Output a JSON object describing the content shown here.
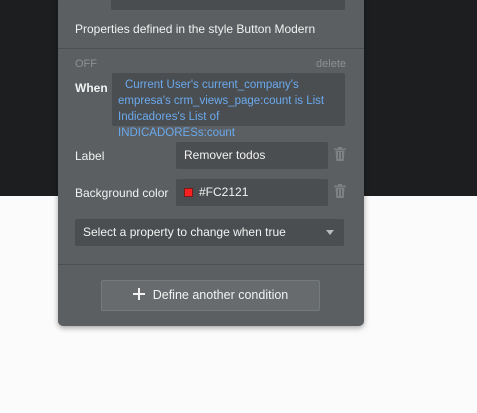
{
  "panel": {
    "section_title": "Properties defined in the style Button Modern",
    "condition": {
      "status": "OFF",
      "delete_label": "delete",
      "when_label": "When",
      "expression": "Current User's current_company's empresa's crm_views_page:count is List Indicadores's List of INDICADORESs:count"
    },
    "fields": {
      "label": {
        "name": "Label",
        "value": "Remover todos"
      },
      "background_color": {
        "name": "Background color",
        "value": "#FC2121",
        "swatch_color": "#FC2121"
      }
    },
    "property_select": {
      "placeholder": "Select a property to change when true"
    },
    "define_button_label": "Define another condition"
  },
  "icons": [
    "trash-icon",
    "chevron-down-icon",
    "plus-icon"
  ]
}
